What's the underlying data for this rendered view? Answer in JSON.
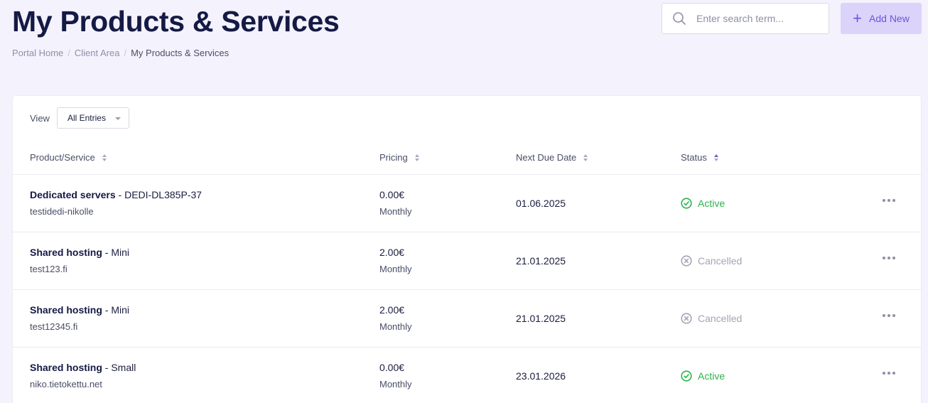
{
  "header": {
    "title": "My Products & Services",
    "breadcrumb": [
      "Portal Home",
      "Client Area",
      "My Products & Services"
    ],
    "search_placeholder": "Enter search term...",
    "add_new_label": "Add New"
  },
  "filter": {
    "view_label": "View",
    "selected": "All Entries"
  },
  "table": {
    "columns": [
      "Product/Service",
      "Pricing",
      "Next Due Date",
      "Status"
    ],
    "rows": [
      {
        "group": "Dedicated servers",
        "plan": " - DEDI-DL385P-37",
        "domain": "testidedi-nikolle",
        "price": "0.00€",
        "cycle": "Monthly",
        "due": "01.06.2025",
        "status": "Active"
      },
      {
        "group": "Shared hosting",
        "plan": " - Mini",
        "domain": "test123.fi",
        "price": "2.00€",
        "cycle": "Monthly",
        "due": "21.01.2025",
        "status": "Cancelled"
      },
      {
        "group": "Shared hosting",
        "plan": " - Mini",
        "domain": "test12345.fi",
        "price": "2.00€",
        "cycle": "Monthly",
        "due": "21.01.2025",
        "status": "Cancelled"
      },
      {
        "group": "Shared hosting",
        "plan": " - Small",
        "domain": "niko.tietokettu.net",
        "price": "0.00€",
        "cycle": "Monthly",
        "due": "23.01.2026",
        "status": "Active"
      }
    ]
  },
  "colors": {
    "accent": "#6b55d9",
    "active": "#2bb24c",
    "cancelled": "#a3a5b5",
    "background": "#f4f2fd"
  },
  "icons": {
    "search": "search-icon",
    "add": "plus-icon",
    "active": "check-circle-icon",
    "cancelled": "x-circle-icon",
    "more": "more-dots-icon"
  }
}
